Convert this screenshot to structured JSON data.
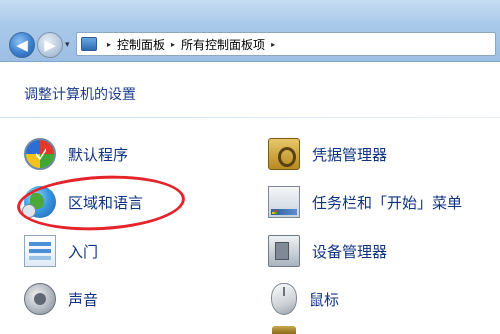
{
  "toolbar": {
    "back_glyph": "◀",
    "forward_glyph": "▶",
    "history_glyph": "▾"
  },
  "address_bar": {
    "separator": "▸",
    "crumbs": [
      "控制面板",
      "所有控制面板项"
    ]
  },
  "page": {
    "title": "调整计算机的设置"
  },
  "items": {
    "default_programs": {
      "label": "默认程序",
      "icon": "default-programs-icon"
    },
    "region_language": {
      "label": "区域和语言",
      "icon": "globe-clock-icon"
    },
    "getting_started": {
      "label": "入门",
      "icon": "getting-started-icon"
    },
    "sound": {
      "label": "声音",
      "icon": "speaker-icon"
    },
    "credential_manager": {
      "label": "凭据管理器",
      "icon": "vault-icon"
    },
    "taskbar_start": {
      "label": "任务栏和「开始」菜单",
      "icon": "taskbar-icon"
    },
    "device_manager": {
      "label": "设备管理器",
      "icon": "device-manager-icon"
    },
    "mouse": {
      "label": "鼠标",
      "icon": "mouse-icon"
    }
  },
  "annotation": {
    "color": "#e4232a",
    "target": "区域和语言"
  }
}
